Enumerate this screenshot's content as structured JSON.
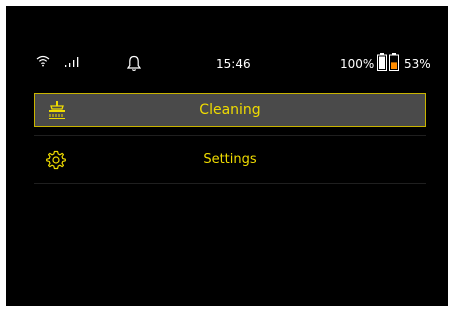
{
  "status_bar": {
    "time": "15:46",
    "battery1_percent": "100%",
    "battery2_percent": "53%",
    "battery1_level": 1.0,
    "battery2_level": 0.53,
    "icons": [
      "wifi-icon",
      "signal-icon",
      "bell-icon",
      "battery-icon"
    ]
  },
  "menu": {
    "items": [
      {
        "label": "Cleaning",
        "icon": "brush-icon",
        "selected": true
      },
      {
        "label": "Settings",
        "icon": "gear-icon",
        "selected": false
      }
    ]
  },
  "colors": {
    "background": "#000000",
    "accent": "#f0dc00",
    "selected_fill": "#4a4a4a",
    "battery_low": "#ff8c00"
  }
}
